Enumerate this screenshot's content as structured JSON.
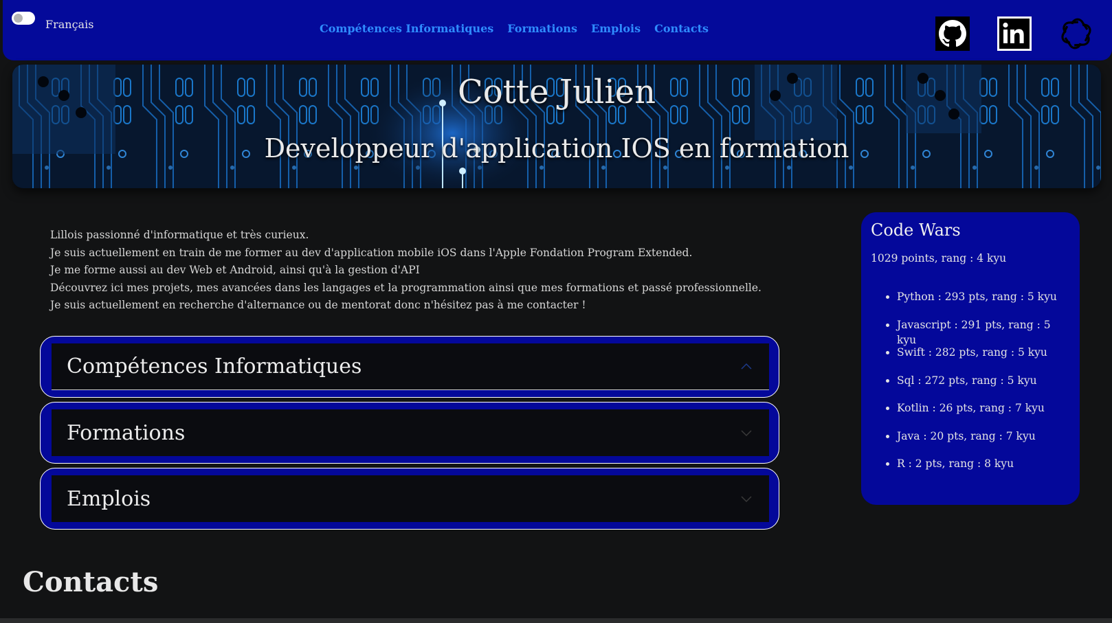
{
  "nav": {
    "language_label": "Français",
    "links": [
      "Compétences Informatiques",
      "Formations",
      "Emplois",
      "Contacts"
    ],
    "social": [
      "github-icon",
      "linkedin-icon",
      "openai-icon"
    ]
  },
  "hero": {
    "title": "Cotte Julien",
    "subtitle": "Developpeur d'application IOS en formation"
  },
  "intro": {
    "lines": [
      "Lillois passionné d'informatique et très curieux.",
      "Je suis actuellement en train de me former au dev d'application mobile iOS dans l'Apple Fondation Program Extended.",
      "Je me forme aussi au dev Web et Android, ainsi qu'à la gestion d'API",
      "Découvrez ici mes projets, mes avancées dans les langages et la programmation ainsi que mes formations et passé professionnelle.",
      "Je suis actuellement en recherche d'alternance ou de mentorat donc n'hésitez pas à me contacter !"
    ]
  },
  "accordion": [
    {
      "title": "Compétences Informatiques",
      "expanded": true
    },
    {
      "title": "Formations",
      "expanded": false
    },
    {
      "title": "Emplois",
      "expanded": false
    }
  ],
  "contacts": {
    "title": "Contacts"
  },
  "codewars": {
    "title": "Code Wars",
    "summary": "1029 points, rang : 4 kyu",
    "languages": [
      "Python : 293 pts, rang : 5 kyu",
      "Javascript : 291 pts, rang : 5 kyu",
      "Swift : 282 pts, rang : 5 kyu",
      "Sql : 272 pts, rang : 5 kyu",
      "Kotlin : 26 pts, rang : 7 kyu",
      "Java : 20 pts, rang : 7 kyu",
      "R : 2 pts, rang : 8 kyu"
    ]
  },
  "colors": {
    "background": "#121314",
    "brand_blue": "#040a9a",
    "link_blue": "#2f8cff",
    "panel_dark": "#0b0c10"
  }
}
